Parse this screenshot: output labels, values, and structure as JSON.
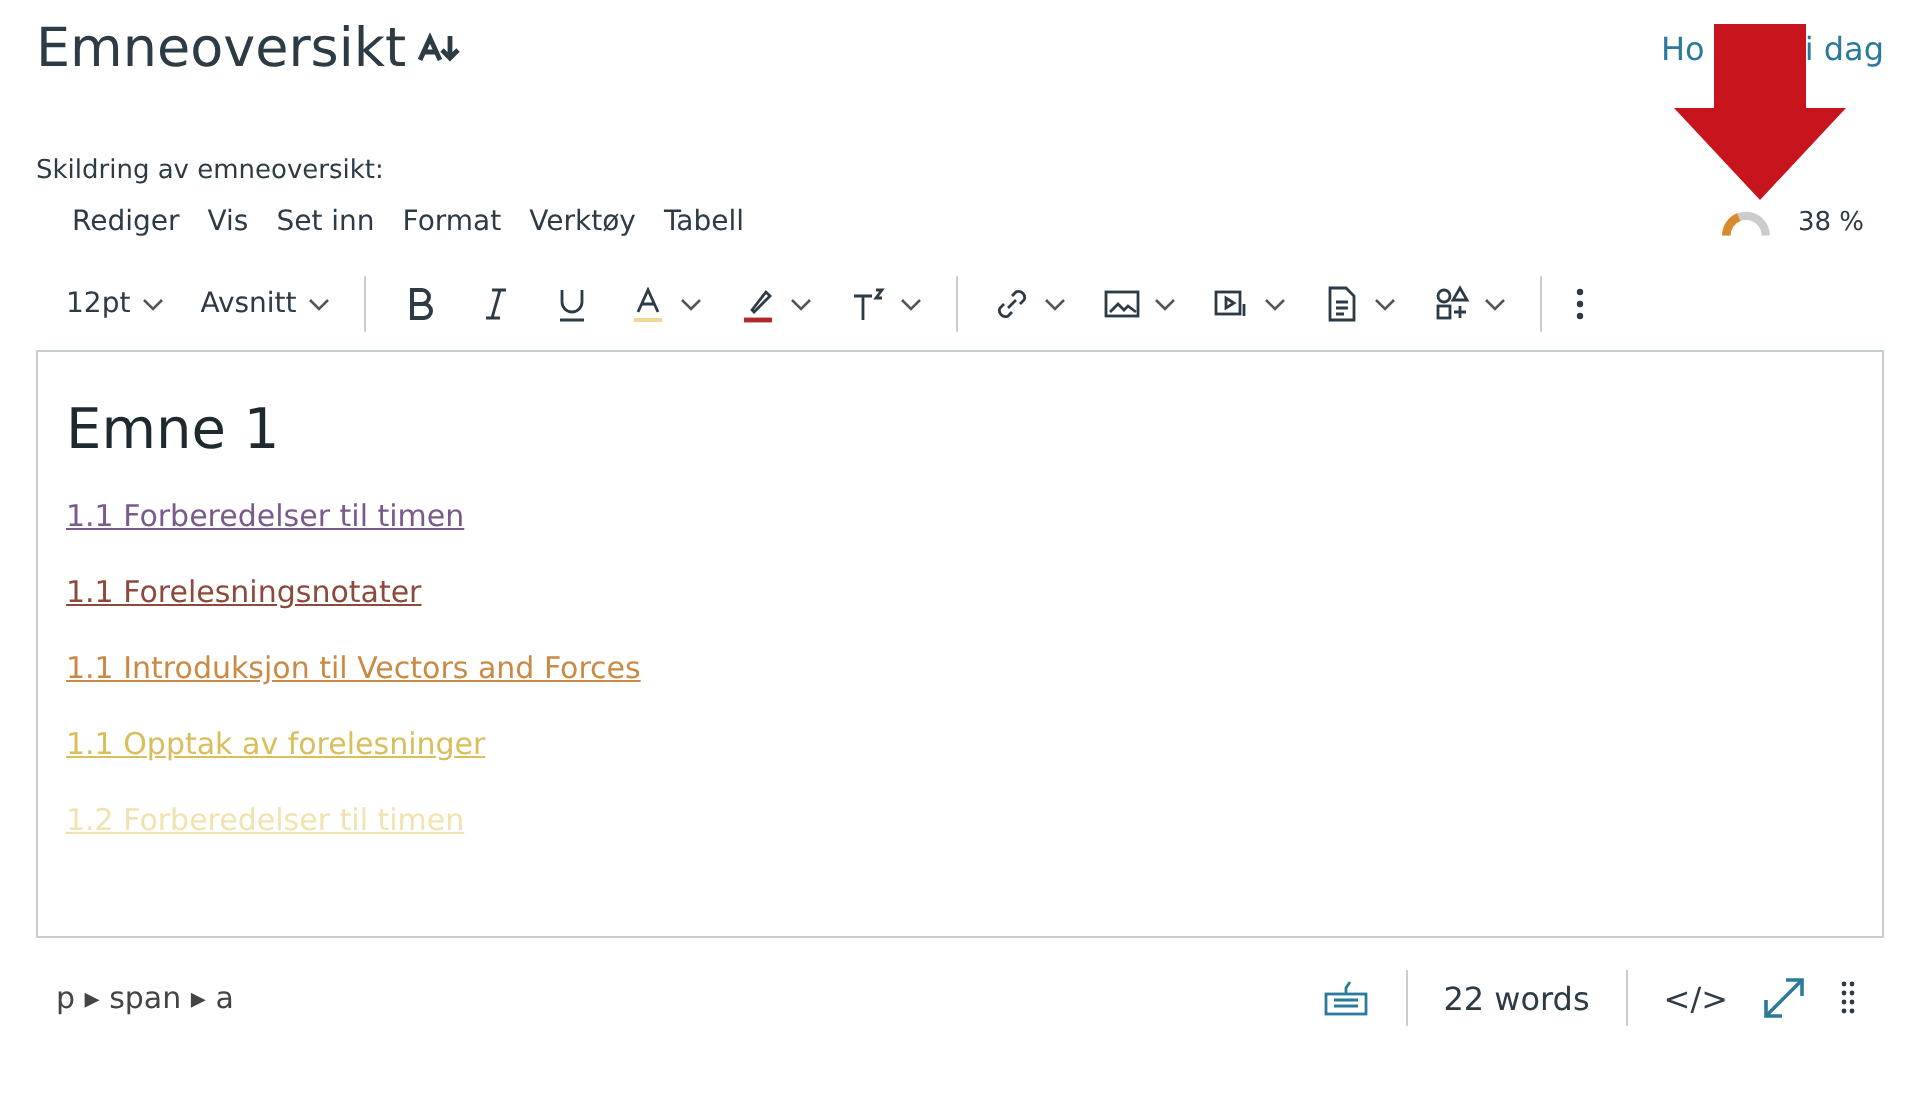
{
  "header": {
    "title": "Emneoversikt",
    "today_link_parts": [
      "Ho",
      "i dag"
    ]
  },
  "description_label": "Skildring av emneoversikt:",
  "menu": [
    "Rediger",
    "Vis",
    "Set inn",
    "Format",
    "Verktøy",
    "Tabell"
  ],
  "accessibility": {
    "reading": "38 %"
  },
  "toolbar": {
    "font_size": "12pt",
    "block": "Avsnitt"
  },
  "content": {
    "heading": "Emne 1",
    "links": [
      {
        "text": "1.1 Forberedelser til timen",
        "color": "#7a5a8c"
      },
      {
        "text": "1.1 Forelesningsnotater",
        "color": "#8c4a3c"
      },
      {
        "text": "1.1 Introduksjon til Vectors and Forces",
        "color": "#c98a45"
      },
      {
        "text": "1.1 Opptak av forelesninger",
        "color": "#d9bf5c"
      },
      {
        "text": "1.2 Forberedelser til timen",
        "color": "#f1e3b0"
      }
    ]
  },
  "status": {
    "path": "p ▸ span ▸ a",
    "words": "22 words",
    "html_toggle": "</>"
  }
}
